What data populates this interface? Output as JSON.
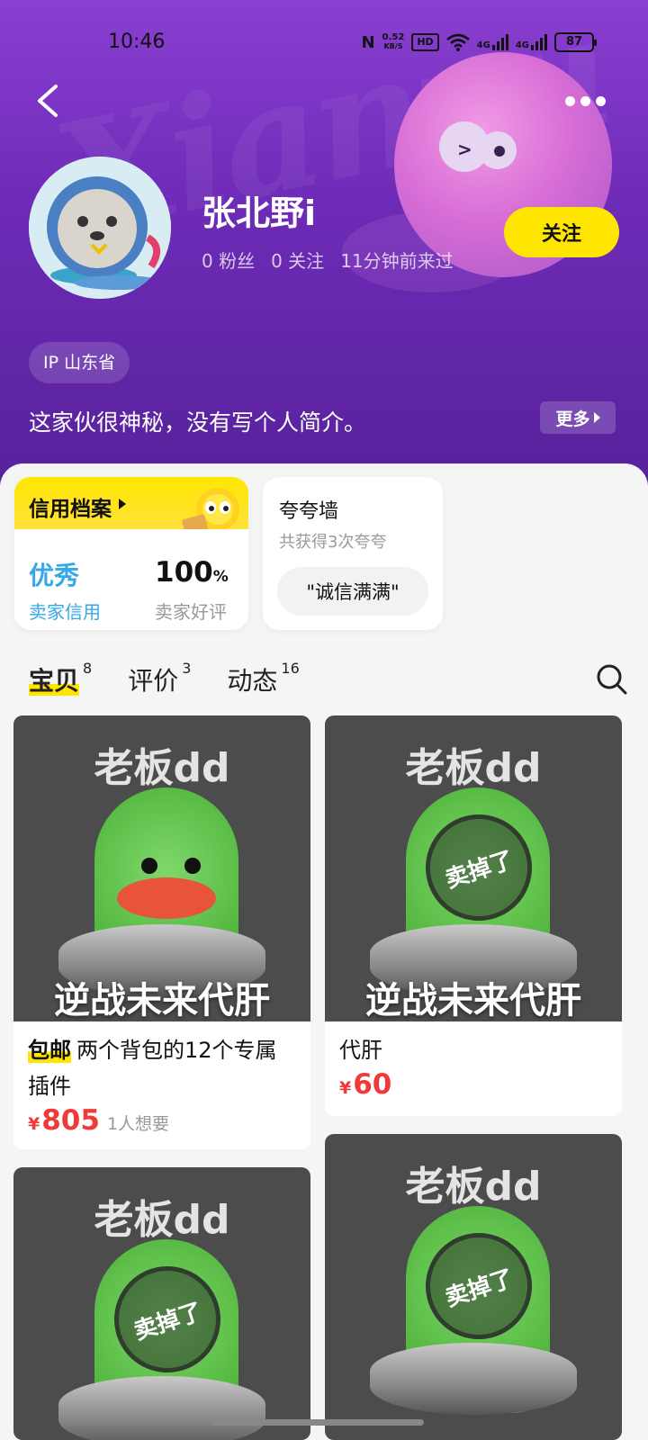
{
  "status_bar": {
    "time": "10:46",
    "net_speed_value": "0.52",
    "net_speed_unit": "KB/S",
    "hd_label": "HD",
    "sim1_label": "4G",
    "sim2_label": "4G",
    "battery": "87"
  },
  "header": {
    "watermark": "Xianyu"
  },
  "profile": {
    "name": "张北野i",
    "fans": "0 粉丝",
    "following": "0 关注",
    "last_seen": "11分钟前来过",
    "follow_label": "关注",
    "ip_label": "IP 山东省",
    "bio": "这家伙很神秘，没有写个人简介。",
    "more_label": "更多"
  },
  "credit": {
    "title": "信用档案",
    "grade": "优秀",
    "grade_label": "卖家信用",
    "rate": "100",
    "rate_unit": "%",
    "rate_label": "卖家好评"
  },
  "praise": {
    "title": "夸夸墙",
    "subtitle": "共获得3次夸夸",
    "tag": "\"诚信满满\""
  },
  "tabs": [
    {
      "label": "宝贝",
      "count": "8"
    },
    {
      "label": "评价",
      "count": "3"
    },
    {
      "label": "动态",
      "count": "16"
    }
  ],
  "items": [
    {
      "img_top": "老板dd",
      "img_bottom": "逆战未来代肝",
      "tag": "包邮",
      "title": "两个背包的12个专属插件",
      "currency": "¥",
      "price": "805",
      "wants": "1人想要",
      "sold": false
    },
    {
      "img_top": "老板dd",
      "img_bottom": "逆战未来代肝",
      "tag": "",
      "title": "代肝",
      "currency": "¥",
      "price": "60",
      "wants": "",
      "sold": true,
      "stamp": "卖掉了"
    },
    {
      "img_top": "老板dd",
      "sold": true,
      "stamp": "卖掉了"
    },
    {
      "img_top": "老板dd",
      "sold": true,
      "stamp": "卖掉了"
    }
  ],
  "colors": {
    "header_purple": "#6e2bb7",
    "accent_yellow": "#ffe600",
    "price_red": "#f03a3a",
    "credit_blue": "#35a9e8"
  }
}
